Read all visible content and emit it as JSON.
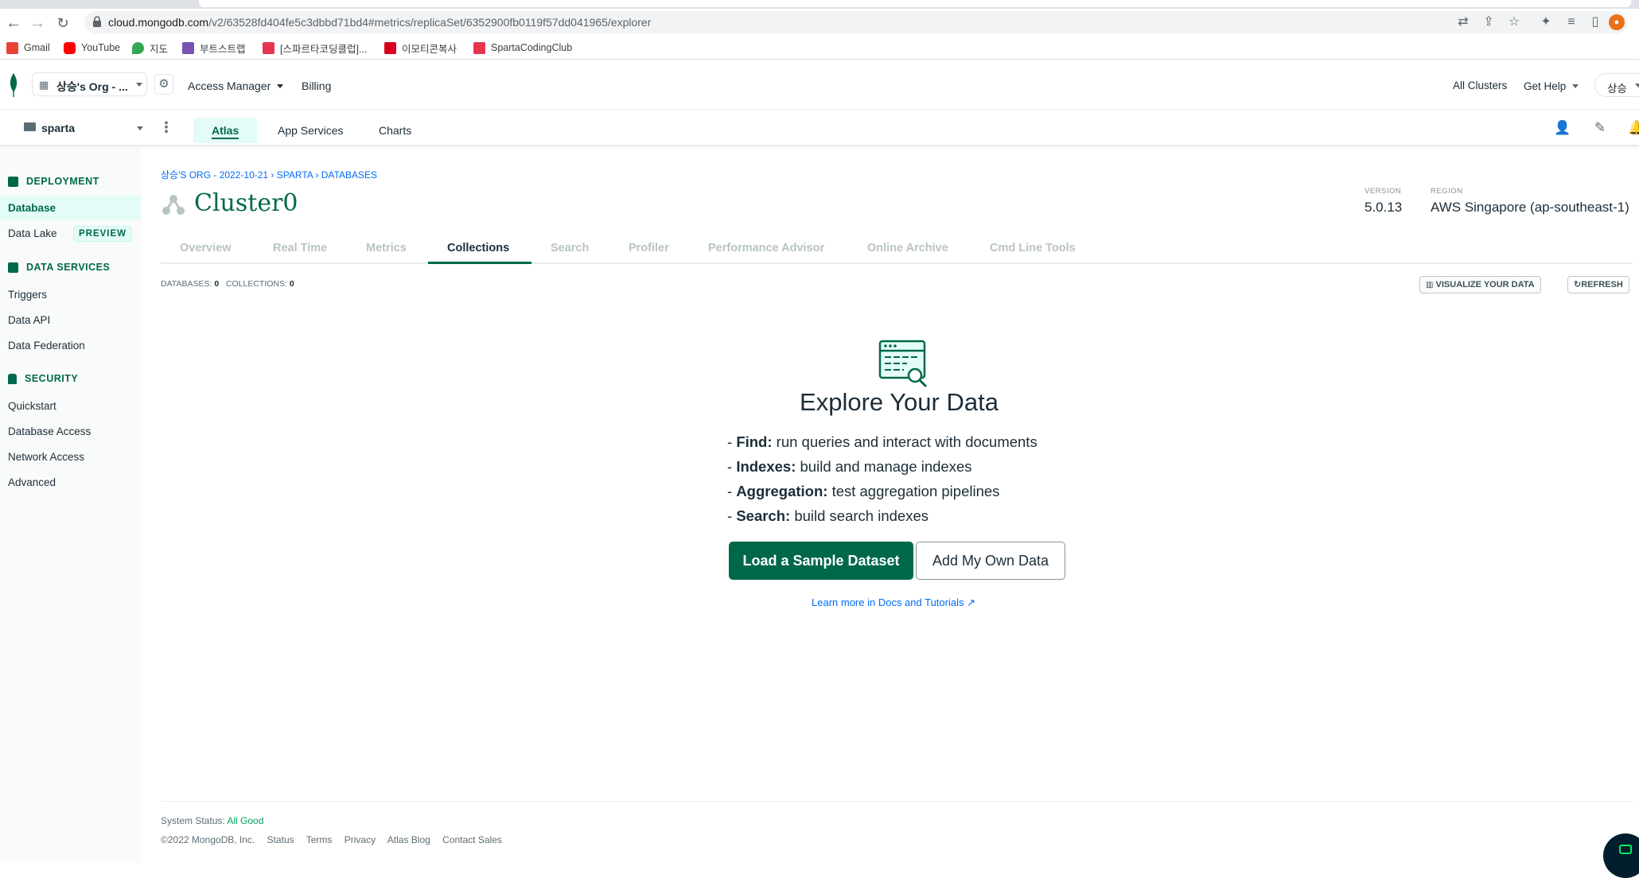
{
  "browser": {
    "url_host": "cloud.mongodb.com",
    "url_path": "/v2/63528fd404fe5c3dbbd71bd4#metrics/replicaSet/6352900fb0119f57dd041965/explorer",
    "bookmarks": [
      "Gmail",
      "YouTube",
      "지도",
      "부트스트랩",
      "[스파르타코딩클럽]...",
      "이모티콘복사",
      "SpartaCodingClub"
    ]
  },
  "topnav": {
    "org_name": "상승's Org - ...",
    "access_manager": "Access Manager",
    "billing": "Billing",
    "all_clusters": "All Clusters",
    "get_help": "Get Help",
    "user": "상승"
  },
  "projnav": {
    "project": "sparta",
    "tabs": [
      "Atlas",
      "App Services",
      "Charts"
    ]
  },
  "sidebar": {
    "deployment": "DEPLOYMENT",
    "database": "Database",
    "data_lake": "Data Lake",
    "preview": "PREVIEW",
    "data_services": "DATA SERVICES",
    "triggers": "Triggers",
    "data_api": "Data API",
    "data_federation": "Data Federation",
    "security": "SECURITY",
    "quickstart": "Quickstart",
    "database_access": "Database Access",
    "network_access": "Network Access",
    "advanced": "Advanced"
  },
  "main": {
    "breadcrumb": "상승'S ORG - 2022-10-21 › SPARTA › DATABASES",
    "cluster_name": "Cluster0",
    "version_label": "VERSION",
    "version": "5.0.13",
    "region_label": "REGION",
    "region": "AWS Singapore (ap-southeast-1)",
    "tabs": [
      "Overview",
      "Real Time",
      "Metrics",
      "Collections",
      "Search",
      "Profiler",
      "Performance Advisor",
      "Online Archive",
      "Cmd Line Tools"
    ],
    "databases_label": "DATABASES:",
    "databases_count": "0",
    "collections_label": "COLLECTIONS:",
    "collections_count": "0",
    "visualize": "VISUALIZE YOUR DATA",
    "refresh": "REFRESH",
    "explore_title": "Explore Your Data",
    "bullets": [
      {
        "key": "Find:",
        "text": "run queries and interact with documents"
      },
      {
        "key": "Indexes:",
        "text": "build and manage indexes"
      },
      {
        "key": "Aggregation:",
        "text": "test aggregation pipelines"
      },
      {
        "key": "Search:",
        "text": "build search indexes"
      }
    ],
    "load_sample": "Load a Sample Dataset",
    "add_own": "Add My Own Data",
    "learn_more": "Learn more in Docs and Tutorials"
  },
  "footer": {
    "status_label": "System Status:",
    "status_value": "All Good",
    "copyright": "©2022 MongoDB, Inc.",
    "links": [
      "Status",
      "Terms",
      "Privacy",
      "Atlas Blog",
      "Contact Sales"
    ]
  },
  "colors": {
    "accent": "#00684a",
    "link": "#016bf8",
    "active_bg": "#e3fcf7"
  }
}
